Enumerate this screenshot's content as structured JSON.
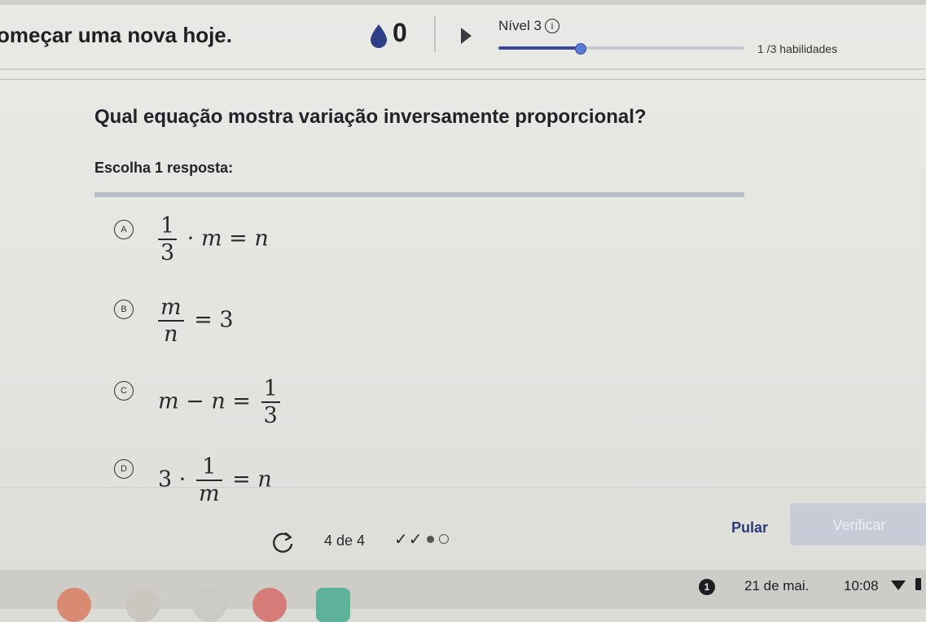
{
  "header": {
    "title": "omeçar uma nova hoje.",
    "energy_count": "0",
    "level_label": "Nível 3",
    "info_symbol": "i",
    "level_progress": 0.33,
    "skills_text": "1 /3 habilidades"
  },
  "question": {
    "text": "Qual equação mostra variação inversamente proporcional?",
    "prompt": "Escolha 1 resposta:"
  },
  "choices": [
    {
      "letter": "A",
      "expr": {
        "frac_num": "1",
        "frac_den": "3",
        "rest": "· m = n"
      }
    },
    {
      "letter": "B",
      "expr": {
        "frac_num": "m",
        "frac_den": "n",
        "rest": "= 3"
      }
    },
    {
      "letter": "C",
      "expr": {
        "lead": "m − n =",
        "frac_num": "1",
        "frac_den": "3"
      }
    },
    {
      "letter": "D",
      "expr": {
        "lead": "3 ·",
        "frac_num": "1",
        "frac_den": "m",
        "rest": "= n"
      }
    }
  ],
  "footer": {
    "counter": "4 de 4",
    "checks": "✓✓",
    "skip_label": "Pular",
    "verify_label": "Verificar"
  },
  "taskbar": {
    "notification_count": "1",
    "date": "21 de mai.",
    "time": "10:08"
  },
  "colors": {
    "accent": "#3b4a98",
    "verify_bg": "#c8ccd6",
    "skip_text": "#2b3a7a"
  }
}
